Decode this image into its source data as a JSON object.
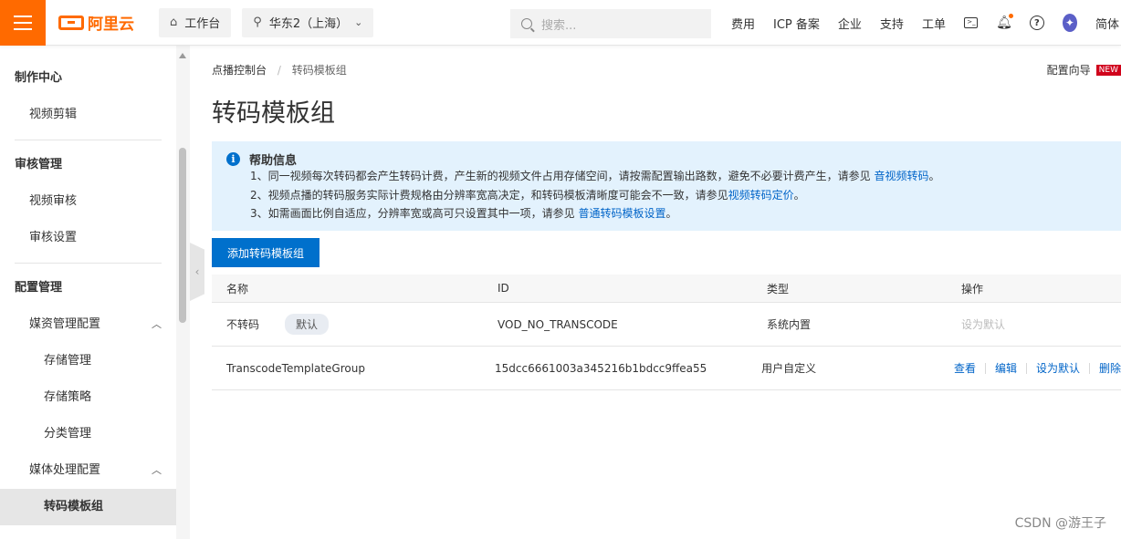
{
  "topbar": {
    "logo_text": "阿里云",
    "workbench_label": "工作台",
    "region_label": "华东2（上海）",
    "search_placeholder": "搜索...",
    "links": [
      "费用",
      "ICP 备案",
      "企业",
      "支持",
      "工单"
    ],
    "lang_label": "简体",
    "accent_color": "#ff6a00"
  },
  "sidebar": {
    "sections": [
      {
        "title": "制作中心",
        "items": [
          "视频剪辑"
        ]
      },
      {
        "title": "审核管理",
        "items": [
          "视频审核",
          "审核设置"
        ]
      },
      {
        "title": "配置管理"
      }
    ],
    "media_config": {
      "label": "媒资管理配置",
      "children": [
        "存储管理",
        "存储策略",
        "分类管理"
      ]
    },
    "process_config": {
      "label": "媒体处理配置",
      "children": [
        "转码模板组"
      ]
    }
  },
  "breadcrumb": [
    "点播控制台",
    "转码模板组"
  ],
  "guide": {
    "label": "配置向导",
    "badge": "NEW"
  },
  "page_title": "转码模板组",
  "help": {
    "title": "帮助信息",
    "line1_text": "1、同一视频每次转码都会产生转码计费，产生新的视频文件占用存储空间，请按需配置输出路数，避免不必要计费产生，请参见 ",
    "line1_link": "音视频转码",
    "line1_end": "。",
    "line2_text": "2、视频点播的转码服务实际计费规格由分辨率宽高决定，和转码模板清晰度可能会不一致，请参见",
    "line2_link": "视频转码定价",
    "line2_end": "。",
    "line3_text": "3、如需画面比例自适应，分辨率宽或高可只设置其中一项，请参见 ",
    "line3_link": "普通转码模板设置",
    "line3_end": "。"
  },
  "add_button": "添加转码模板组",
  "table": {
    "headers": [
      "名称",
      "ID",
      "类型",
      "操作"
    ],
    "rows": [
      {
        "name": "不转码",
        "badge": "默认",
        "id": "VOD_NO_TRANSCODE",
        "type": "系统内置",
        "actions": [
          "设为默认"
        ]
      },
      {
        "name": "TranscodeTemplateGroup",
        "id": "15dcc6661003a345216b1bdcc9ffea55",
        "type": "用户自定义",
        "actions": [
          "查看",
          "编辑",
          "设为默认",
          "删除"
        ]
      }
    ]
  },
  "watermark": "CSDN @游王子"
}
